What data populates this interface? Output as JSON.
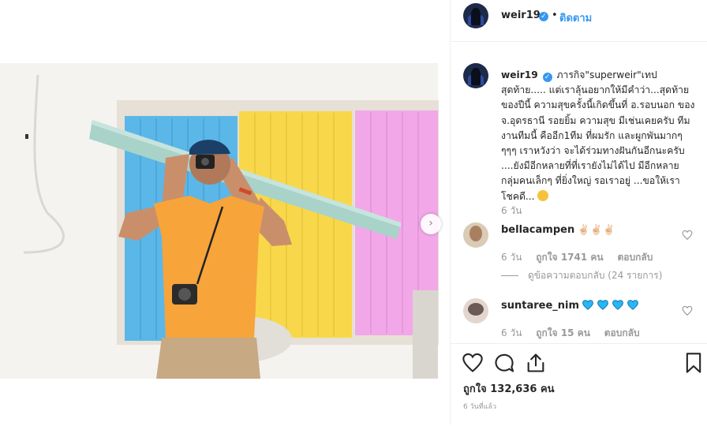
{
  "post": {
    "author": "weir19",
    "follow_label": "ติดตาม",
    "dot": "•",
    "caption_user": "weir19",
    "caption_text": "ภารกิจ\"superweir\"เทปสุดท้าย..... แต่เราลุ้นอยากให้มีคำว่า...สุดท้ายของปีนี้ ความสุขครั้งนี้เกิดขึ้นที่ อ.รอบนอก ของ จ.อุดรธานี รอยยิ้ม ความสุข มีเช่นเคยครับ ทีมงานทีมนี้ คืออีก1ทีม ที่ผมรัก และผูกพันมากๆๆๆๆ เราหวังว่า จะได้ร่วมทางฝันกันอีกนะครับ ....ยังมีอีกหลายที่ที่เรายังไม่ได้ไป มีอีกหลายกลุ่มคนเล็กๆ ที่ยิ่งใหญ่ รอเราอยู่ ...ขอให้เราโชคดี...",
    "caption_time": "6 วัน"
  },
  "comments": [
    {
      "user": "bellacampen",
      "emoji": [
        "✌🏻",
        "✌🏻",
        "✌🏻"
      ],
      "time": "6 วัน",
      "likes": "ถูกใจ 1741 คน",
      "reply": "ตอบกลับ",
      "view_replies": "ดูข้อความตอบกลับ (24 รายการ)"
    },
    {
      "user": "suntaree_nim",
      "emoji_count": 4,
      "time": "6 วัน",
      "likes": "ถูกใจ 15 คน",
      "reply": "ตอบกลับ"
    }
  ],
  "actions": {
    "likes_total": "ถูกใจ 132,636 คน",
    "post_time": "6 วันที่แล้ว",
    "icons": [
      "heart-icon",
      "comment-icon",
      "share-icon",
      "bookmark-icon"
    ]
  },
  "colors": {
    "accent": "#3897f0",
    "muted": "#999999",
    "heart_blue": "#29b6f6"
  }
}
